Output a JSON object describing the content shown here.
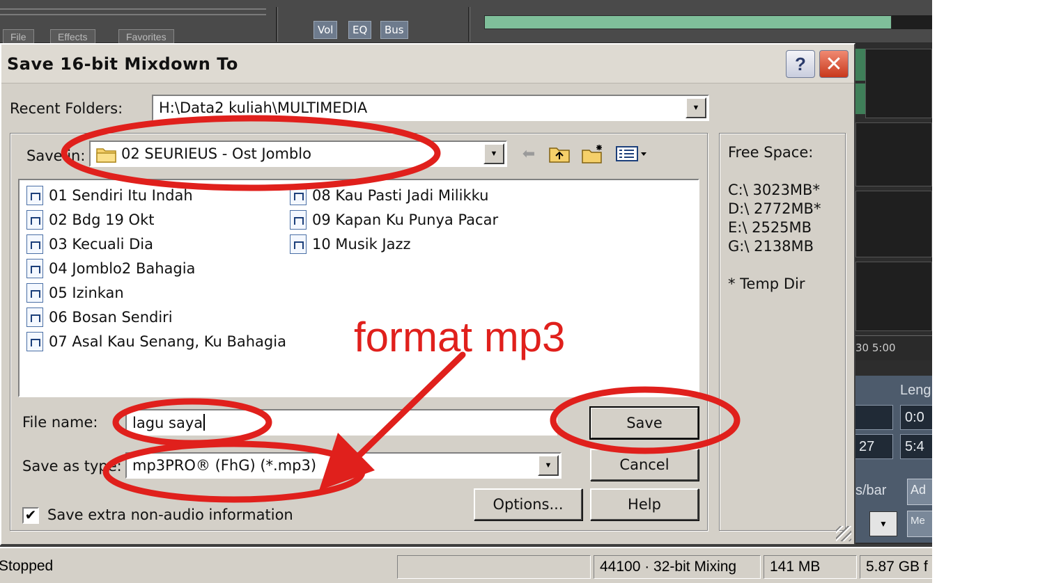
{
  "app": {
    "mixer_buttons": [
      "Vol",
      "EQ",
      "Bus"
    ],
    "tabs": [
      "File",
      "Effects",
      "Favorites"
    ],
    "ruler_text": "30   5:00",
    "length_label": "Leng",
    "time_values": [
      "0:0",
      "5:4"
    ],
    "left_time_value": "27",
    "bars_label": "s/bar",
    "add_button": "Ad",
    "m_button": "Me"
  },
  "statusbar": {
    "state": "Stopped",
    "empty": "",
    "mixing": "44100 · 32-bit Mixing",
    "memory": "141 MB",
    "disk": "5.87 GB f"
  },
  "dialog": {
    "title": "Save 16-bit Mixdown To",
    "help_label": "?",
    "close_label": "✕",
    "recent_label": "Recent Folders:",
    "recent_value": "H:\\Data2 kuliah\\MULTIMEDIA",
    "save_in_label": "Save in:",
    "save_in_value": "02 SEURIEUS - Ost Jomblo",
    "files": [
      "01 Sendiri Itu Indah",
      "02 Bdg 19 Okt",
      "03 Kecuali Dia",
      "04 Jomblo2 Bahagia",
      "05 Izinkan",
      "06 Bosan Sendiri",
      "07 Asal Kau Senang, Ku Bahagia",
      "08 Kau Pasti Jadi Milikku",
      "09 Kapan Ku Punya Pacar",
      "10 Musik Jazz"
    ],
    "filename_label": "File name:",
    "filename_value": "lagu saya",
    "type_label": "Save as type:",
    "type_value": "mp3PRO® (FhG) (*.mp3)",
    "checkbox_label": "Save extra non-audio information",
    "checkbox_checked": true,
    "buttons": {
      "save": "Save",
      "cancel": "Cancel",
      "options": "Options...",
      "help": "Help"
    },
    "free_space": {
      "title": "Free Space:",
      "drives": [
        "C:\\  3023MB*",
        "D:\\  2772MB*",
        "E:\\  2525MB",
        "G:\\  2138MB"
      ],
      "note": "* Temp Dir"
    }
  },
  "annotation": {
    "text": "format mp3",
    "color": "#e0201c"
  }
}
